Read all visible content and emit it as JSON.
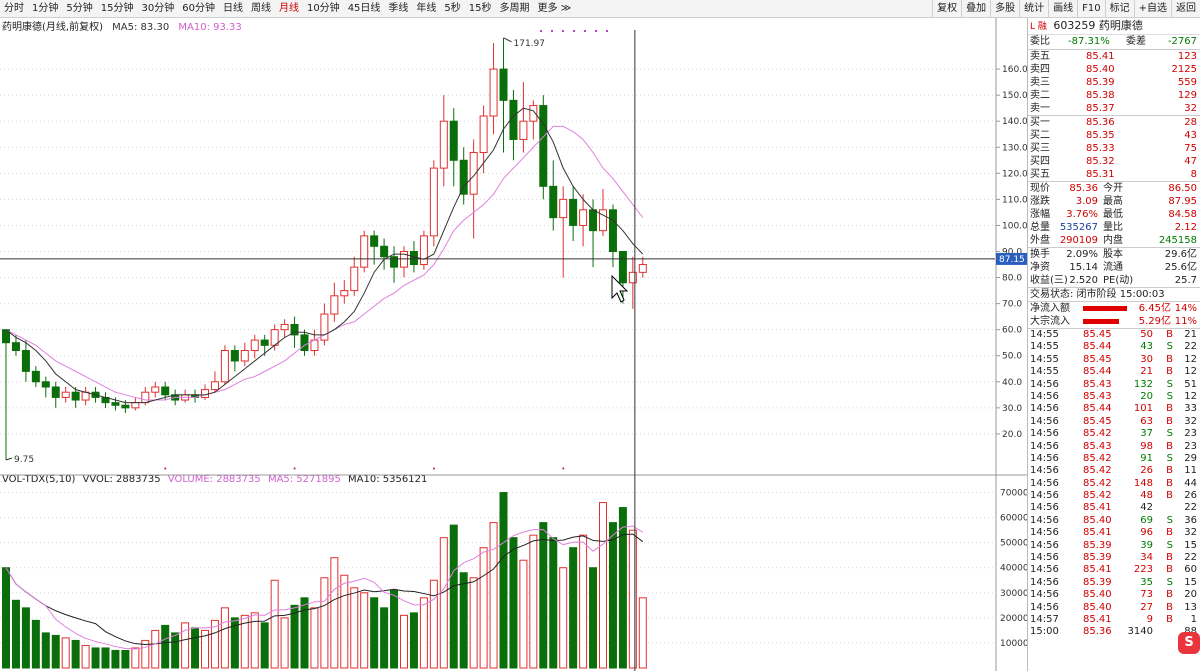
{
  "toolbar": {
    "items": [
      "分时",
      "1分钟",
      "5分钟",
      "15分钟",
      "30分钟",
      "60分钟",
      "日线",
      "周线",
      "月线",
      "10分钟",
      "45日线",
      "季线",
      "年线",
      "5秒",
      "15秒",
      "多周期",
      "更多"
    ],
    "active_index": 8,
    "right_buttons": [
      "复权",
      "叠加",
      "多股",
      "统计",
      "画线",
      "F10",
      "标记",
      "+自选",
      "返回"
    ]
  },
  "chart": {
    "title": "药明康德(月线,前复权)",
    "ma5_label": "MA5: 83.30",
    "ma10_label": "MA10: 93.33",
    "high_marker": "171.97",
    "low_marker": "9.75",
    "crosshair_price": "87.15",
    "vol_legend": {
      "name": "VOL-TDX(5,10)",
      "vvol": "VVOL: 2883735",
      "volume": "VOLUME: 2883735",
      "ma5": "MA5: 5271895",
      "ma10": "MA10: 5356121"
    },
    "colors": {
      "up": "#e03030",
      "down": "#0a6e0a",
      "ma5": "#333333",
      "ma10": "#e080e0"
    }
  },
  "chart_data": {
    "type": "candlestick",
    "price_axis": {
      "ticks": [
        20,
        30,
        40,
        50,
        60,
        70,
        80,
        90,
        100,
        110,
        120,
        130,
        140,
        150,
        160
      ],
      "range": [
        5,
        175
      ]
    },
    "volume_axis": {
      "ticks": [
        10000,
        20000,
        30000,
        40000,
        50000,
        60000,
        70000
      ],
      "range": [
        0,
        75000
      ]
    },
    "candles": [
      [
        60,
        55,
        10,
        59
      ],
      [
        55,
        52,
        50,
        58
      ],
      [
        52,
        44,
        40,
        56
      ],
      [
        44,
        40,
        38,
        46
      ],
      [
        40,
        38,
        34,
        42
      ],
      [
        38,
        34,
        30,
        40
      ],
      [
        34,
        36,
        32,
        38
      ],
      [
        36,
        33,
        30,
        38
      ],
      [
        33,
        36,
        31,
        38
      ],
      [
        36,
        34,
        32,
        38
      ],
      [
        34,
        32,
        30,
        36
      ],
      [
        32,
        31,
        29,
        34
      ],
      [
        31,
        30,
        28,
        33
      ],
      [
        30,
        32,
        29,
        34
      ],
      [
        32,
        36,
        31,
        38
      ],
      [
        36,
        38,
        34,
        40
      ],
      [
        38,
        35,
        33,
        40
      ],
      [
        35,
        33,
        31,
        37
      ],
      [
        33,
        35,
        32,
        37
      ],
      [
        35,
        34,
        32,
        37
      ],
      [
        34,
        37,
        33,
        39
      ],
      [
        37,
        40,
        36,
        44
      ],
      [
        40,
        52,
        39,
        54
      ],
      [
        52,
        48,
        44,
        54
      ],
      [
        48,
        52,
        46,
        55
      ],
      [
        52,
        56,
        49,
        58
      ],
      [
        56,
        54,
        50,
        58
      ],
      [
        54,
        60,
        52,
        62
      ],
      [
        60,
        62,
        57,
        64
      ],
      [
        62,
        58,
        53,
        65
      ],
      [
        58,
        52,
        50,
        60
      ],
      [
        52,
        56,
        50,
        60
      ],
      [
        56,
        66,
        54,
        70
      ],
      [
        66,
        73,
        63,
        78
      ],
      [
        73,
        75,
        70,
        79
      ],
      [
        75,
        84,
        73,
        88
      ],
      [
        84,
        96,
        82,
        98
      ],
      [
        96,
        92,
        85,
        98
      ],
      [
        92,
        88,
        83,
        95
      ],
      [
        88,
        84,
        78,
        92
      ],
      [
        84,
        90,
        80,
        92
      ],
      [
        90,
        85,
        82,
        94
      ],
      [
        85,
        96,
        83,
        98
      ],
      [
        96,
        122,
        92,
        125
      ],
      [
        122,
        140,
        115,
        150
      ],
      [
        140,
        125,
        115,
        145
      ],
      [
        125,
        112,
        108,
        130
      ],
      [
        112,
        128,
        95,
        133
      ],
      [
        128,
        142,
        120,
        146
      ],
      [
        142,
        160,
        135,
        170
      ],
      [
        160,
        148,
        128,
        172
      ],
      [
        148,
        133,
        125,
        152
      ],
      [
        133,
        140,
        128,
        155
      ],
      [
        140,
        146,
        133,
        148
      ],
      [
        146,
        115,
        110,
        150
      ],
      [
        115,
        103,
        98,
        125
      ],
      [
        103,
        110,
        80,
        115
      ],
      [
        110,
        100,
        94,
        115
      ],
      [
        100,
        106,
        92,
        112
      ],
      [
        106,
        98,
        84,
        110
      ],
      [
        98,
        106,
        96,
        114
      ],
      [
        106,
        90,
        84,
        108
      ],
      [
        90,
        78,
        70,
        90
      ],
      [
        78,
        82,
        68,
        88
      ],
      [
        82,
        85,
        80,
        88
      ]
    ],
    "ma5": [
      60,
      57,
      55,
      52,
      48,
      43,
      40,
      37,
      36,
      35,
      34,
      33,
      32,
      32,
      32,
      33,
      34,
      35,
      35,
      35,
      35,
      36,
      39,
      42,
      45,
      48,
      51,
      54,
      57,
      59,
      59,
      58,
      58,
      60,
      63,
      67,
      74,
      82,
      87,
      89,
      89,
      88,
      87,
      89,
      98,
      107,
      115,
      119,
      124,
      129,
      137,
      142,
      145,
      144,
      139,
      132,
      122,
      115,
      110,
      106,
      104,
      102,
      98,
      93,
      89
    ],
    "ma10": [
      60,
      58,
      56,
      54,
      51,
      48,
      46,
      44,
      42,
      40,
      38,
      36,
      35,
      34,
      33,
      33,
      33,
      34,
      34,
      34,
      35,
      36,
      37,
      39,
      41,
      42,
      44,
      46,
      48,
      51,
      54,
      56,
      58,
      60,
      62,
      63,
      66,
      69,
      72,
      74,
      77,
      79,
      81,
      85,
      91,
      98,
      102,
      105,
      108,
      112,
      118,
      122,
      126,
      130,
      134,
      138,
      138,
      136,
      133,
      128,
      122,
      118,
      113,
      108,
      103
    ],
    "volume": [
      40000,
      27000,
      24000,
      19000,
      14000,
      13000,
      12000,
      11000,
      9000,
      8000,
      8000,
      7000,
      7000,
      8000,
      11000,
      15000,
      17000,
      14000,
      18000,
      16000,
      15000,
      19000,
      24000,
      20000,
      21000,
      22000,
      18000,
      35000,
      20000,
      25000,
      28000,
      24000,
      36000,
      44000,
      37000,
      32000,
      30000,
      28000,
      24000,
      31000,
      21000,
      22000,
      28000,
      35000,
      52000,
      57000,
      38000,
      36000,
      48000,
      58000,
      70000,
      52000,
      43000,
      53000,
      58000,
      52000,
      40000,
      48000,
      53000,
      40000,
      66000,
      58000,
      64000,
      55000,
      28000
    ]
  },
  "right_panel": {
    "code_header": "603259 药明康德",
    "prefix": "L 融",
    "weibi_label": "委比",
    "weibi_value": "-87.31%",
    "weicha_label": "委差",
    "weicha_value": "-2767",
    "sell_rows": [
      {
        "label": "卖五",
        "price": "85.41",
        "vol": "123"
      },
      {
        "label": "卖四",
        "price": "85.40",
        "vol": "2125"
      },
      {
        "label": "卖三",
        "price": "85.39",
        "vol": "559"
      },
      {
        "label": "卖二",
        "price": "85.38",
        "vol": "129"
      },
      {
        "label": "卖一",
        "price": "85.37",
        "vol": "32"
      }
    ],
    "buy_rows": [
      {
        "label": "买一",
        "price": "85.36",
        "vol": "28"
      },
      {
        "label": "买二",
        "price": "85.35",
        "vol": "43"
      },
      {
        "label": "买三",
        "price": "85.33",
        "vol": "75"
      },
      {
        "label": "买四",
        "price": "85.32",
        "vol": "47"
      },
      {
        "label": "买五",
        "price": "85.31",
        "vol": "8"
      }
    ],
    "quote_rows": [
      {
        "l1": "现价",
        "v1": "85.36",
        "l2": "今开",
        "v2": "86.50"
      },
      {
        "l1": "涨跌",
        "v1": "3.09",
        "l2": "最高",
        "v2": "87.95"
      },
      {
        "l1": "涨幅",
        "v1": "3.76%",
        "l2": "最低",
        "v2": "84.58"
      },
      {
        "l1": "总量",
        "v1": "535267",
        "l2": "量比",
        "v2": "2.12"
      },
      {
        "l1": "外盘",
        "v1": "290109",
        "l2": "内盘",
        "v2": "245158"
      }
    ],
    "stat_rows": [
      {
        "l1": "换手",
        "v1": "2.09%",
        "l2": "股本",
        "v2": "29.6亿"
      },
      {
        "l1": "净资",
        "v1": "15.14",
        "l2": "流通",
        "v2": "25.6亿"
      },
      {
        "l1": "收益(三)",
        "v1": "2.520",
        "l2": "PE(动)",
        "v2": "25.7"
      }
    ],
    "trade_status": "交易状态: 闭市阶段 15:00:03",
    "flows": [
      {
        "label": "净流入额",
        "value": "6.45亿",
        "pct": "14%",
        "ratio": 0.55
      },
      {
        "label": "大宗流入",
        "value": "5.29亿",
        "pct": "11%",
        "ratio": 0.45
      }
    ],
    "ticks": [
      [
        "14:55",
        "85.45",
        "50",
        "B",
        "21"
      ],
      [
        "14:55",
        "85.44",
        "43",
        "S",
        "22"
      ],
      [
        "14:55",
        "85.45",
        "30",
        "B",
        "12"
      ],
      [
        "14:55",
        "85.44",
        "21",
        "B",
        "12"
      ],
      [
        "14:56",
        "85.43",
        "132",
        "S",
        "51"
      ],
      [
        "14:56",
        "85.43",
        "20",
        "S",
        "12"
      ],
      [
        "14:56",
        "85.44",
        "101",
        "B",
        "33"
      ],
      [
        "14:56",
        "85.45",
        "63",
        "B",
        "32"
      ],
      [
        "14:56",
        "85.42",
        "37",
        "S",
        "23"
      ],
      [
        "14:56",
        "85.43",
        "98",
        "B",
        "23"
      ],
      [
        "14:56",
        "85.42",
        "91",
        "S",
        "29"
      ],
      [
        "14:56",
        "85.42",
        "26",
        "B",
        "11"
      ],
      [
        "14:56",
        "85.42",
        "148",
        "B",
        "44"
      ],
      [
        "14:56",
        "85.42",
        "48",
        "B",
        "26"
      ],
      [
        "14:56",
        "85.41",
        "42",
        "",
        "22"
      ],
      [
        "14:56",
        "85.40",
        "69",
        "S",
        "36"
      ],
      [
        "14:56",
        "85.41",
        "96",
        "B",
        "32"
      ],
      [
        "14:56",
        "85.39",
        "39",
        "S",
        "15"
      ],
      [
        "14:56",
        "85.39",
        "34",
        "B",
        "22"
      ],
      [
        "14:56",
        "85.41",
        "223",
        "B",
        "60"
      ],
      [
        "14:56",
        "85.39",
        "35",
        "S",
        "15"
      ],
      [
        "14:56",
        "85.40",
        "73",
        "B",
        "20"
      ],
      [
        "14:56",
        "85.40",
        "27",
        "B",
        "13"
      ],
      [
        "14:57",
        "85.41",
        "9",
        "B",
        "1"
      ],
      [
        "15:00",
        "85.36",
        "3140",
        "",
        "88"
      ]
    ]
  }
}
